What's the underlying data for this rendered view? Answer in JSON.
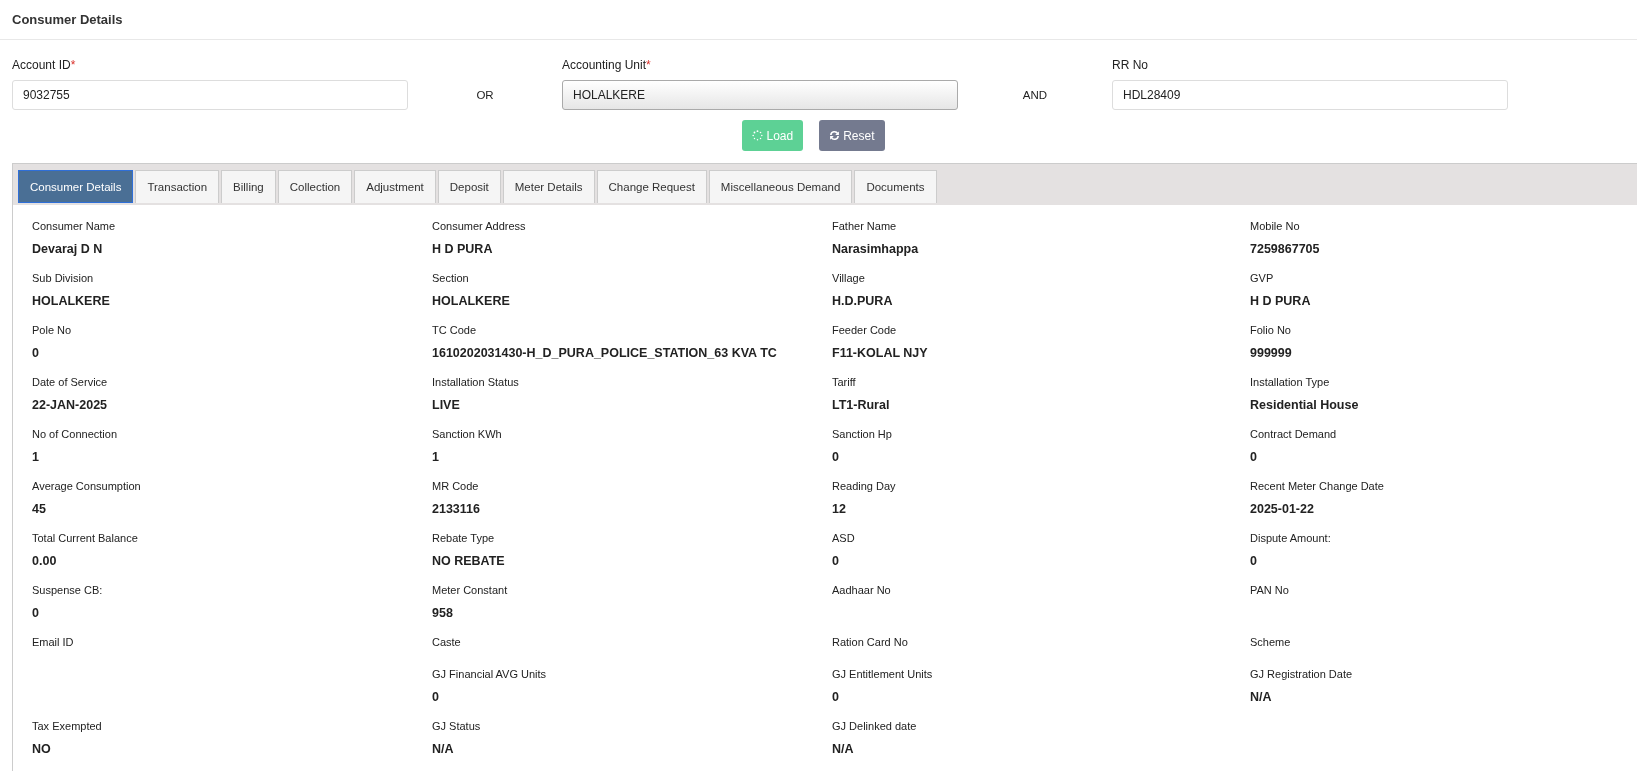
{
  "page_title": "Consumer Details",
  "search": {
    "account_id": {
      "label": "Account ID",
      "mark": "*",
      "value": "9032755"
    },
    "or_text": "OR",
    "accounting_unit": {
      "label": "Accounting Unit",
      "mark": "*",
      "value": "HOLALKERE"
    },
    "and_text": "AND",
    "rr_no": {
      "label": "RR No",
      "value": "HDL28409"
    },
    "buttons": [
      {
        "label": "Load",
        "kind": "load"
      },
      {
        "label": "Reset",
        "kind": "reset"
      }
    ]
  },
  "tabs": [
    {
      "label": "Consumer Details",
      "selected": true
    },
    {
      "label": "Transaction",
      "selected": false
    },
    {
      "label": "Billing",
      "selected": false
    },
    {
      "label": "Collection",
      "selected": false
    },
    {
      "label": "Adjustment",
      "selected": false
    },
    {
      "label": "Deposit",
      "selected": false
    },
    {
      "label": "Meter Details",
      "selected": false
    },
    {
      "label": "Change Request",
      "selected": false
    },
    {
      "label": "Miscellaneous Demand",
      "selected": false
    },
    {
      "label": "Documents",
      "selected": false
    }
  ],
  "details": [
    [
      {
        "label": "Consumer Name",
        "value": "Devaraj D N"
      },
      {
        "label": "Consumer Address",
        "value": "H D PURA"
      },
      {
        "label": "Father Name",
        "value": "Narasimhappa"
      },
      {
        "label": "Mobile No",
        "value": "7259867705"
      }
    ],
    [
      {
        "label": "Sub Division",
        "value": "HOLALKERE"
      },
      {
        "label": "Section",
        "value": "HOLALKERE"
      },
      {
        "label": "Village",
        "value": "H.D.PURA"
      },
      {
        "label": "GVP",
        "value": "H D PURA"
      }
    ],
    [
      {
        "label": "Pole No",
        "value": "0"
      },
      {
        "label": "TC Code",
        "value": "1610202031430-H_D_PURA_POLICE_STATION_63 KVA TC"
      },
      {
        "label": "Feeder Code",
        "value": "F11-KOLAL NJY"
      },
      {
        "label": "Folio No",
        "value": "999999"
      }
    ],
    [
      {
        "label": "Date of Service",
        "value": "22-JAN-2025"
      },
      {
        "label": "Installation Status",
        "value": "LIVE"
      },
      {
        "label": "Tariff",
        "value": "LT1-Rural"
      },
      {
        "label": "Installation Type",
        "value": "Residential House"
      }
    ],
    [
      {
        "label": "No of Connection",
        "value": "1"
      },
      {
        "label": "Sanction KWh",
        "value": "1"
      },
      {
        "label": "Sanction Hp",
        "value": "0"
      },
      {
        "label": "Contract Demand",
        "value": "0"
      }
    ],
    [
      {
        "label": "Average Consumption",
        "value": "45"
      },
      {
        "label": "MR Code",
        "value": "2133116"
      },
      {
        "label": "Reading Day",
        "value": "12"
      },
      {
        "label": "Recent Meter Change Date",
        "value": "2025-01-22"
      }
    ],
    [
      {
        "label": "Total Current Balance",
        "value": "0.00"
      },
      {
        "label": "Rebate Type",
        "value": "NO REBATE"
      },
      {
        "label": "ASD",
        "value": "0"
      },
      {
        "label": "Dispute Amount:",
        "value": "0"
      }
    ],
    [
      {
        "label": "Suspense CB:",
        "value": "0"
      },
      {
        "label": "Meter Constant",
        "value": "958"
      },
      {
        "label": "Aadhaar No"
      },
      {
        "label": "PAN No"
      }
    ],
    [
      {
        "label": "Email ID"
      },
      {
        "label": "Caste"
      },
      {
        "label": "Ration Card No"
      },
      {
        "label": "Scheme"
      }
    ],
    [
      {
        "kind": "spacer"
      },
      {
        "label": "GJ Financial AVG Units",
        "value": "0"
      },
      {
        "label": "GJ Entitlement Units",
        "value": "0"
      },
      {
        "label": "GJ Registration Date",
        "value": "N/A"
      }
    ],
    [
      {
        "label": "Tax Exempted",
        "value": "NO"
      },
      {
        "label": "GJ Status",
        "value": "N/A"
      },
      {
        "label": "GJ Delinked date",
        "value": "N/A"
      }
    ]
  ]
}
